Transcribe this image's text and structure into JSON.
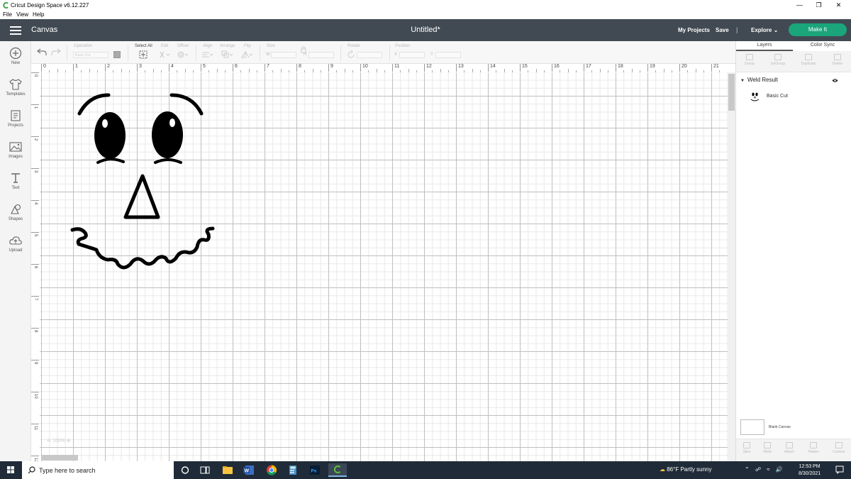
{
  "window": {
    "title": "Cricut Design Space  v6.12.227",
    "menu": [
      "File",
      "View",
      "Help"
    ],
    "controls": [
      "minimize",
      "restore",
      "close"
    ]
  },
  "header": {
    "section": "Canvas",
    "doc_title": "Untitled*",
    "my_projects": "My Projects",
    "save": "Save",
    "separator": "|",
    "explore": "Explore",
    "make_it": "Make It",
    "accent_color": "#1aa57a",
    "bg_color": "#414a52"
  },
  "left_toolbar": [
    {
      "label": "New",
      "icon": "plus-circle-icon"
    },
    {
      "label": "Templates",
      "icon": "tshirt-icon"
    },
    {
      "label": "Projects",
      "icon": "projects-icon"
    },
    {
      "label": "Images",
      "icon": "image-icon"
    },
    {
      "label": "Text",
      "icon": "text-icon"
    },
    {
      "label": "Shapes",
      "icon": "shapes-icon"
    },
    {
      "label": "Upload",
      "icon": "upload-cloud-icon"
    }
  ],
  "edit_toolbar": {
    "undo_icon": "undo-icon",
    "redo_icon": "redo-icon",
    "operation_label": "Operation",
    "operation_value": "Basic Cut",
    "select_all": "Select All",
    "edit": "Edit",
    "offset": "Offset",
    "align": "Align",
    "arrange": "Arrange",
    "flip": "Flip",
    "size": "Size",
    "size_w_prefix": "W",
    "size_h_prefix": "H",
    "rotate": "Rotate",
    "position": "Position",
    "pos_x_prefix": "X",
    "pos_y_prefix": "Y"
  },
  "ruler": {
    "top": [
      "0",
      "1",
      "2",
      "3",
      "4",
      "5",
      "6",
      "7",
      "8",
      "9",
      "10",
      "11",
      "12",
      "13",
      "14",
      "15",
      "16",
      "17",
      "18",
      "19",
      "20",
      "21"
    ],
    "left": [
      "0",
      "1",
      "2",
      "3",
      "4",
      "5",
      "6",
      "7",
      "8",
      "9",
      "10",
      "11",
      "12"
    ]
  },
  "canvas": {
    "zoom_label": "100%",
    "design": "weld-result-face"
  },
  "right_panel": {
    "tabs": [
      "Layers",
      "Color Sync"
    ],
    "tools": [
      "Group",
      "UnGroup",
      "Duplicate",
      "Delete"
    ],
    "layer_group": "Weld Result",
    "layer_item": "Basic Cut",
    "blank_canvas": "Blank Canvas",
    "bottom_tools": [
      "Slice",
      "Weld",
      "Attach",
      "Flatten",
      "Contour"
    ]
  },
  "taskbar": {
    "search_placeholder": "Type here to search",
    "apps": [
      "task-view-icon",
      "file-explorer-icon",
      "word-icon",
      "chrome-icon",
      "calculator-icon",
      "photoshop-icon",
      "cricut-icon"
    ],
    "weather": "86°F  Partly sunny",
    "time": "12:53 PM",
    "date": "8/30/2021"
  }
}
